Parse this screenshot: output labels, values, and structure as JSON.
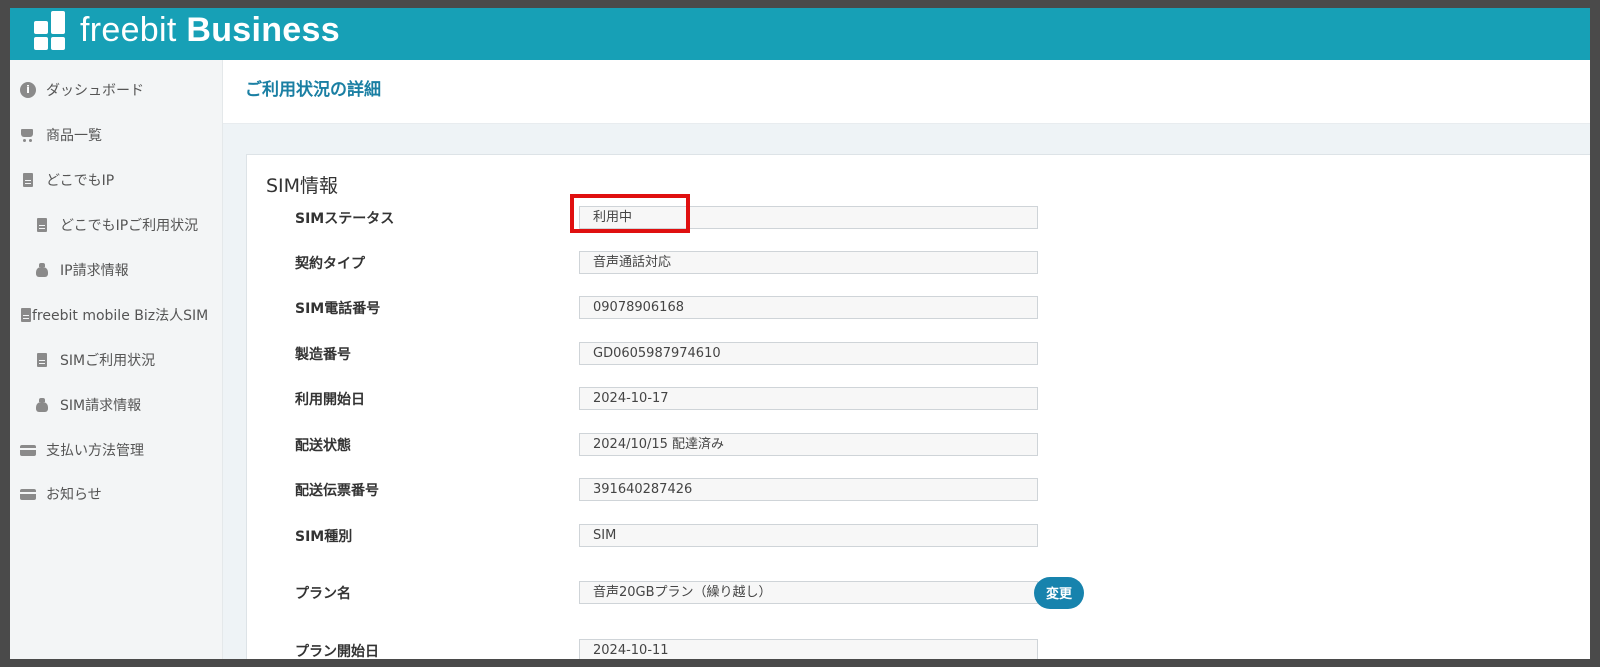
{
  "app": {
    "brand_light": "freebit",
    "brand_bold": "Business",
    "header_color": "#17a0b6",
    "accent_color": "#1a7fa3"
  },
  "sidebar": {
    "items": [
      {
        "label": "ダッシュボード",
        "icon": "info-circle-icon"
      },
      {
        "label": "商品一覧",
        "icon": "cart-icon"
      },
      {
        "label": "どこでもIP",
        "icon": "file-icon"
      },
      {
        "label": "どこでもIPご利用状況",
        "icon": "file-icon"
      },
      {
        "label": "IP請求情報",
        "icon": "money-bag-icon"
      },
      {
        "label": "freebit mobile Biz法人SIM",
        "icon": "file-icon"
      },
      {
        "label": "SIMご利用状況",
        "icon": "file-icon"
      },
      {
        "label": "SIM請求情報",
        "icon": "money-bag-icon"
      },
      {
        "label": "支払い方法管理",
        "icon": "credit-card-icon"
      },
      {
        "label": "お知らせ",
        "icon": "credit-card-icon"
      }
    ]
  },
  "main": {
    "page_title": "ご利用状況の詳細",
    "section_title": "SIM情報",
    "rows": [
      {
        "label": "SIMステータス",
        "value": "利用中"
      },
      {
        "label": "契約タイプ",
        "value": "音声通話対応"
      },
      {
        "label": "SIM電話番号",
        "value": "09078906168"
      },
      {
        "label": "製造番号",
        "value": "GD0605987974610"
      },
      {
        "label": "利用開始日",
        "value": "2024-10-17"
      },
      {
        "label": "配送状態",
        "value": "2024/10/15 配達済み"
      },
      {
        "label": "配送伝票番号",
        "value": "391640287426"
      },
      {
        "label": "SIM種別",
        "value": "SIM"
      },
      {
        "label": "プラン名",
        "value": "音声20GBプラン（繰り越し）"
      },
      {
        "label": "プラン開始日",
        "value": "2024-10-11"
      }
    ],
    "change_button_label": "変更",
    "highlight_color": "#e01010"
  }
}
